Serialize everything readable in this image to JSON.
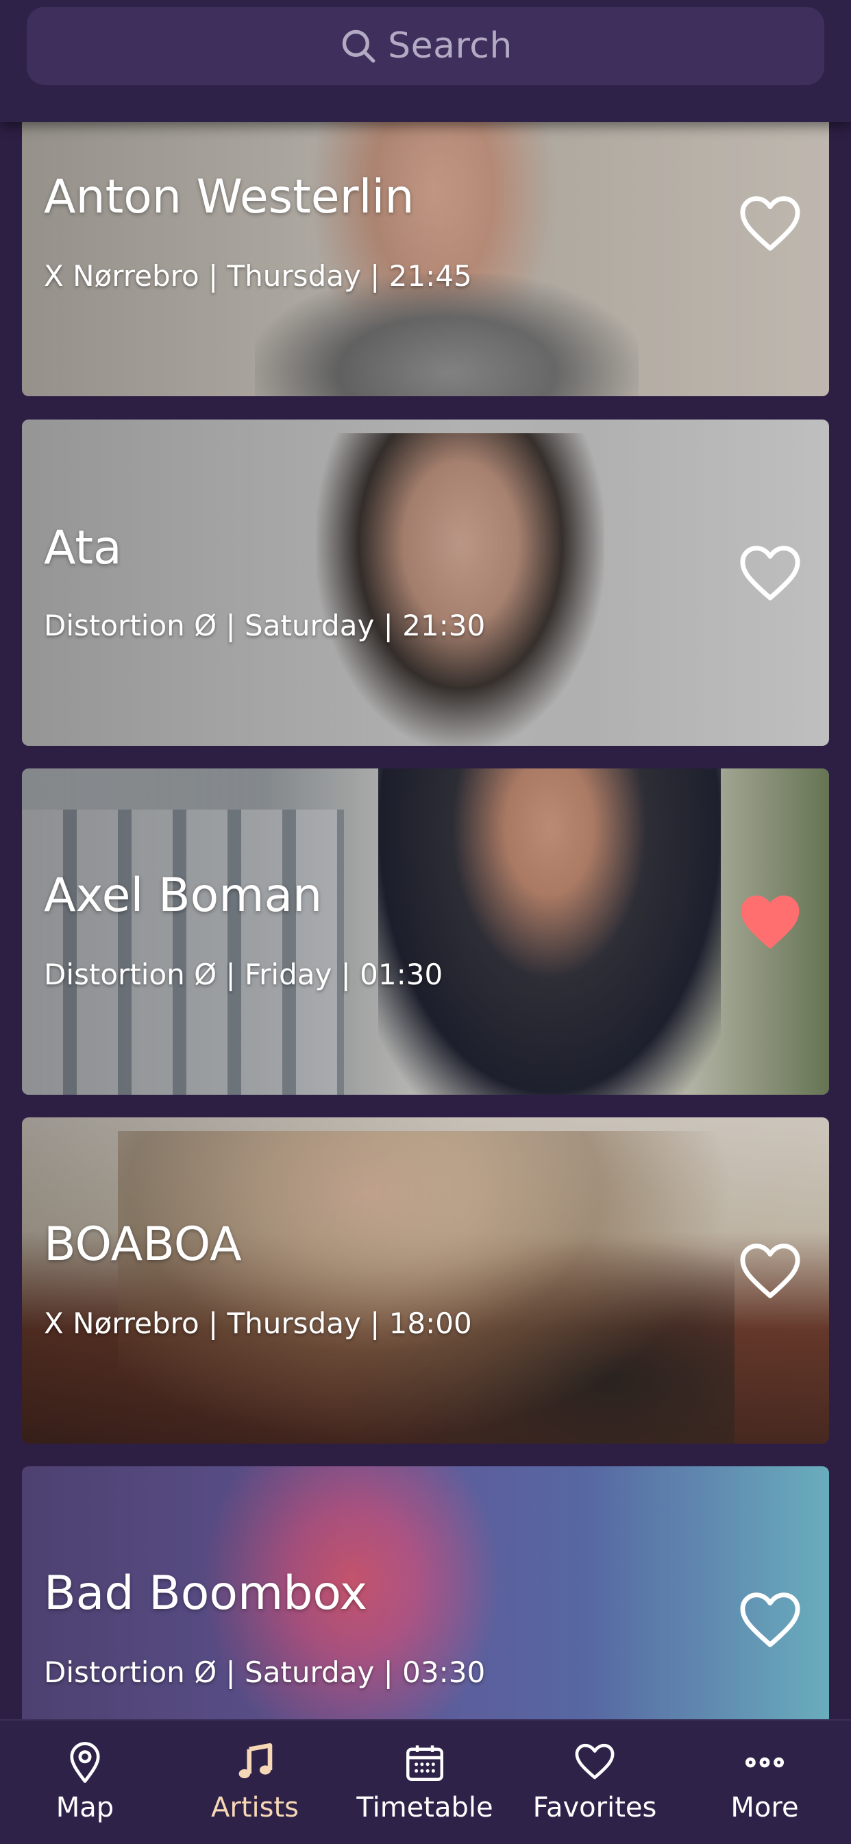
{
  "search": {
    "placeholder": "Search"
  },
  "cards": [
    {
      "name": "Anton Westerlin",
      "meta": "X Nørrebro | Thursday | 21:45",
      "favorited": false
    },
    {
      "name": "Ata",
      "meta": "Distortion Ø | Saturday | 21:30",
      "favorited": false
    },
    {
      "name": "Axel Boman",
      "meta": "Distortion Ø | Friday | 01:30",
      "favorited": true
    },
    {
      "name": "BOABOA",
      "meta": "X Nørrebro | Thursday | 18:00",
      "favorited": false
    },
    {
      "name": "Bad Boombox",
      "meta": "Distortion Ø | Saturday | 03:30",
      "favorited": false
    }
  ],
  "nav": {
    "items": [
      {
        "label": "Map",
        "icon": "map-pin-icon"
      },
      {
        "label": "Artists",
        "icon": "music-note-icon"
      },
      {
        "label": "Timetable",
        "icon": "calendar-icon"
      },
      {
        "label": "Favorites",
        "icon": "heart-icon"
      },
      {
        "label": "More",
        "icon": "more-dots-icon"
      }
    ],
    "active": "Artists"
  },
  "colors": {
    "background": "#2d1f44",
    "header": "#2f2248",
    "search_field": "#3e2f5c",
    "favorite_active": "#ff6f6f",
    "nav_active": "#f6d7b6"
  }
}
